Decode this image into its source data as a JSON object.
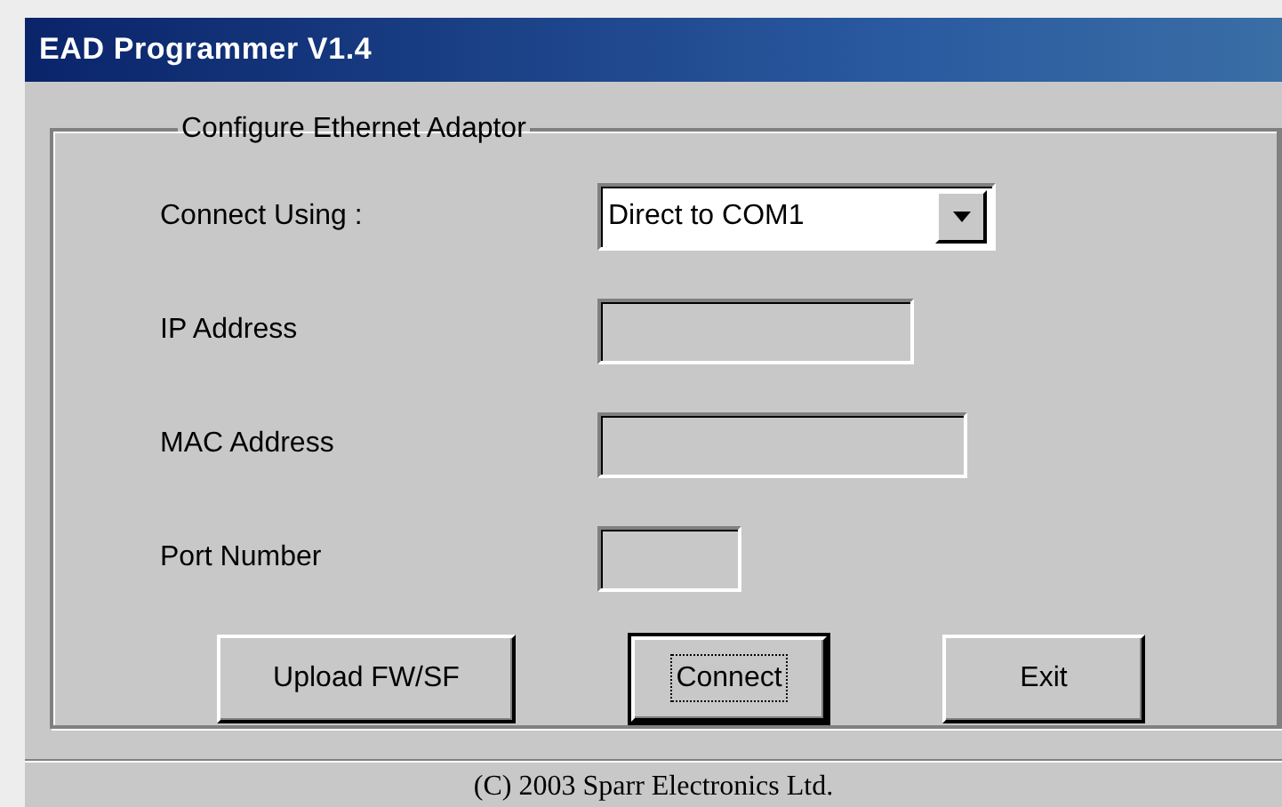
{
  "window": {
    "title": "EAD Programmer V1.4"
  },
  "group": {
    "title": "Configure Ethernet Adaptor"
  },
  "fields": [
    {
      "kind": "dropdown",
      "label": "Connect Using :",
      "value": "Direct to COM1"
    },
    {
      "kind": "text",
      "label": "IP Address"
    },
    {
      "kind": "text",
      "label": "MAC Address"
    },
    {
      "kind": "text",
      "label": "Port Number"
    }
  ],
  "buttons": [
    {
      "label": "Upload FW/SF",
      "default": false
    },
    {
      "label": "Connect",
      "default": true
    },
    {
      "label": "Exit",
      "default": false
    }
  ],
  "status_bar": "(C) 2003 Sparr Electronics Ltd."
}
